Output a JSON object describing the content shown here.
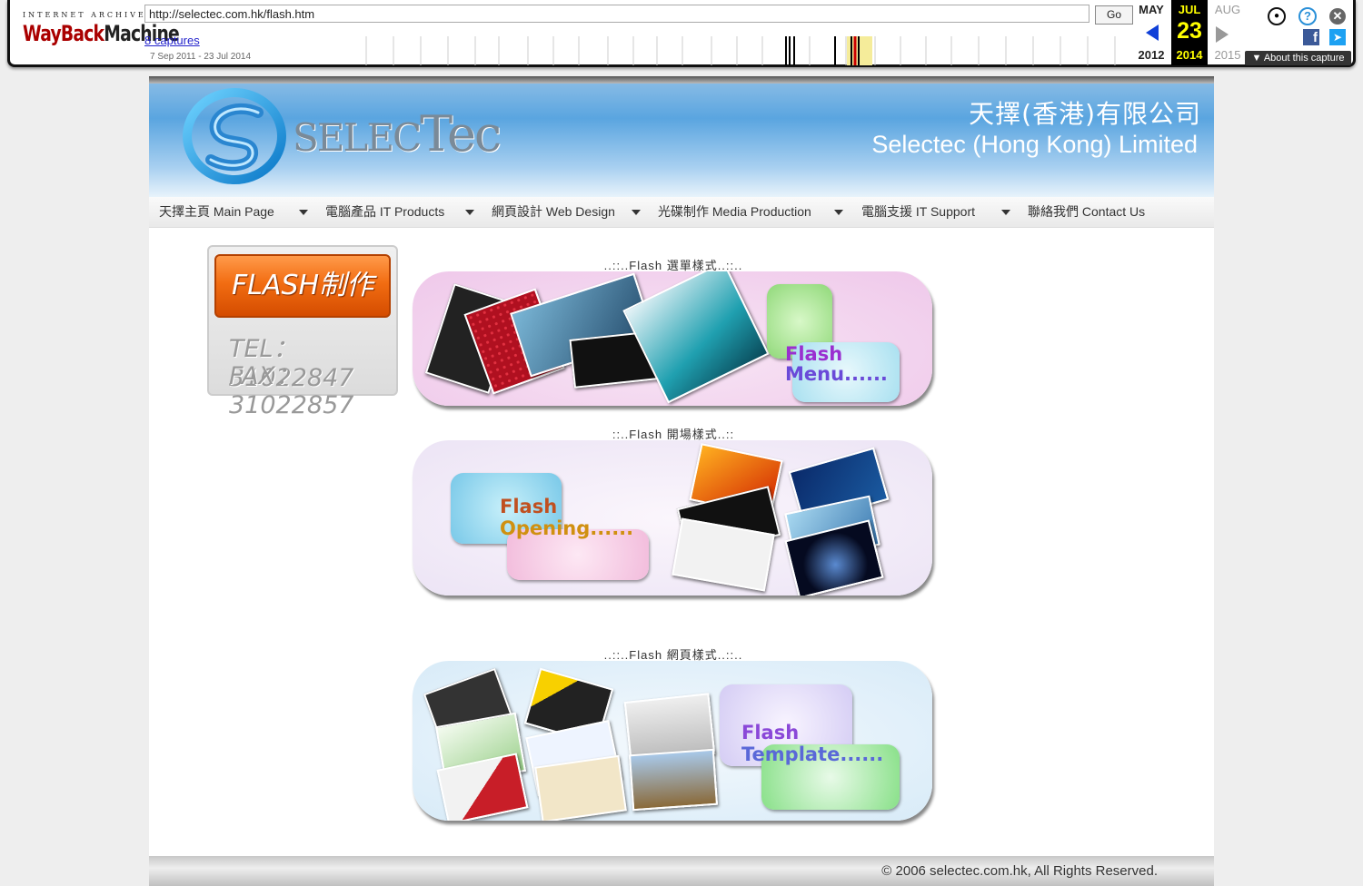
{
  "wayback": {
    "brand_top": "INTERNET ARCHIVE",
    "brand_wayback": "WayBack",
    "brand_machine": "Machine",
    "url": "http://selectec.com.hk/flash.htm",
    "go_label": "Go",
    "captures_label": "8 captures",
    "date_range": "7 Sep 2011 - 23 Jul 2014",
    "prev_month": "MAY",
    "cur_month": "JUL",
    "next_month": "AUG",
    "cur_day": "23",
    "prev_year": "2012",
    "cur_year": "2014",
    "next_year": "2015",
    "about_label": "About this capture"
  },
  "header": {
    "company_zh": "天擇(香港)有限公司",
    "company_en": "Selectec (Hong Kong) Limited",
    "logo_text_a": "SELEC",
    "logo_text_b": "Tec"
  },
  "nav": {
    "items": [
      {
        "label": "天擇主頁 Main Page"
      },
      {
        "label": "電腦產品 IT Products"
      },
      {
        "label": "網頁設計 Web Design"
      },
      {
        "label": "光碟制作 Media Production"
      },
      {
        "label": "電腦支援 IT Support"
      },
      {
        "label": "聯絡我們 Contact Us"
      }
    ]
  },
  "contact_box": {
    "heading": "FLASH制作",
    "tel": "TEL：31022847",
    "fax": "FAX：31022857"
  },
  "sections": [
    {
      "title": "..::..Flash 選單樣式..::..",
      "tag_line1": "Flash",
      "tag_line2": "Menu......"
    },
    {
      "title": "::..Flash 開場樣式..::",
      "tag_line1": "Flash",
      "tag_line2": "Opening......"
    },
    {
      "title": "..::..Flash 網頁樣式..::..",
      "tag_line1": "Flash",
      "tag_line2": "Template......"
    }
  ],
  "footer": {
    "copyright": "© 2006 selectec.com.hk, All Rights Reserved."
  }
}
